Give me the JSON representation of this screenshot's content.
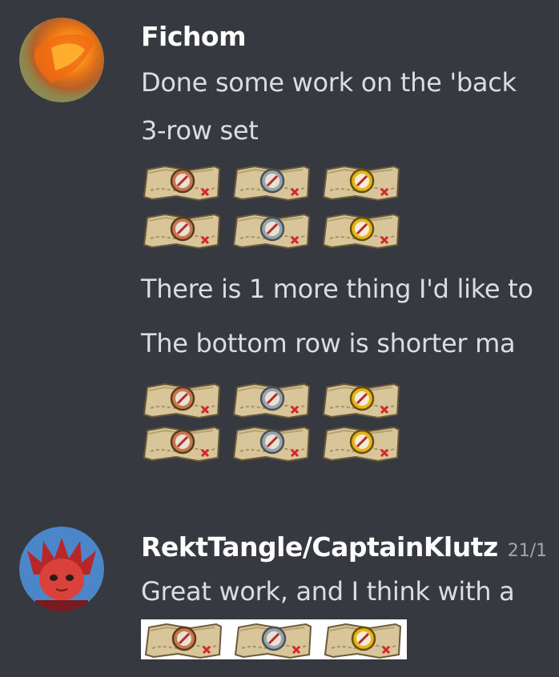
{
  "messages": [
    {
      "author": "Fichom",
      "avatar_icon": "fire-avatar-icon",
      "lines": [
        "Done some work on the 'back",
        "3-row set",
        "There is 1 more thing I'd like to",
        "The bottom row is shorter ma"
      ],
      "emoji_names": [
        "map-compass-bronze",
        "map-compass-silver",
        "map-compass-gold"
      ]
    },
    {
      "author": "RektTangle/CaptainKlutz",
      "timestamp": "21/1",
      "avatar_icon": "red-character-avatar-icon",
      "lines": [
        "Great work, and I think with a"
      ],
      "emoji_names": [
        "map-compass-bronze",
        "map-compass-silver",
        "map-compass-gold"
      ]
    }
  ],
  "colors": {
    "background": "#36393f",
    "text": "#dcddde",
    "author": "#ffffff",
    "bronze": "#c8784a",
    "silver": "#9aa4ad",
    "gold": "#e8b416"
  }
}
